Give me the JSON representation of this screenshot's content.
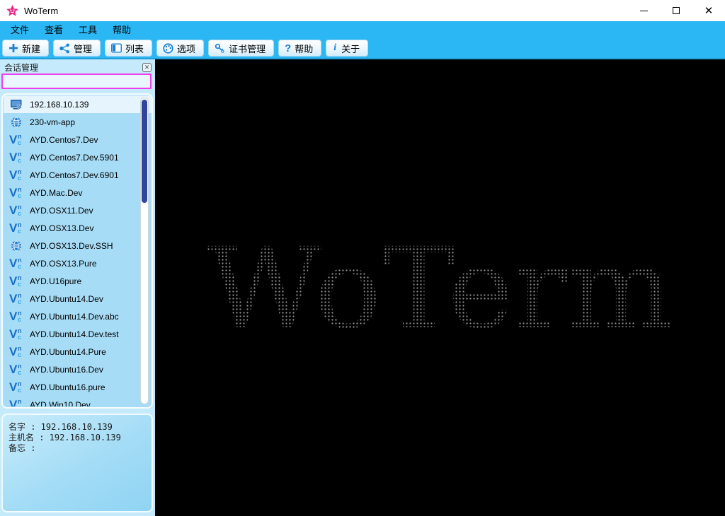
{
  "window": {
    "title": "WoTerm",
    "controls": {
      "minimize": "minimize",
      "maximize": "maximize",
      "close": "×"
    }
  },
  "menu_bar": {
    "items": [
      "文件",
      "查看",
      "工具",
      "帮助"
    ]
  },
  "toolbar": {
    "buttons": [
      {
        "icon": "plus-icon",
        "label": "新建"
      },
      {
        "icon": "share-icon",
        "label": "管理"
      },
      {
        "icon": "panel-icon",
        "label": "列表"
      },
      {
        "icon": "palette-icon",
        "label": "选项"
      },
      {
        "icon": "key-icon",
        "label": "证书管理"
      },
      {
        "icon": "question-icon",
        "label": "帮助"
      },
      {
        "icon": "info-icon",
        "label": "关于"
      }
    ]
  },
  "sidebar": {
    "title": "会话管理",
    "search": {
      "value": "",
      "placeholder": ""
    },
    "sessions": [
      {
        "name": "192.168.10.139",
        "type": "rdp",
        "selected": true
      },
      {
        "name": "230-vm-app",
        "type": "ssh",
        "selected": false
      },
      {
        "name": "AYD.Centos7.Dev",
        "type": "vnc",
        "selected": false
      },
      {
        "name": "AYD.Centos7.Dev.5901",
        "type": "vnc",
        "selected": false
      },
      {
        "name": "AYD.Centos7.Dev.6901",
        "type": "vnc",
        "selected": false
      },
      {
        "name": "AYD.Mac.Dev",
        "type": "vnc",
        "selected": false
      },
      {
        "name": "AYD.OSX11.Dev",
        "type": "vnc",
        "selected": false
      },
      {
        "name": "AYD.OSX13.Dev",
        "type": "vnc",
        "selected": false
      },
      {
        "name": "AYD.OSX13.Dev.SSH",
        "type": "ssh",
        "selected": false
      },
      {
        "name": "AYD.OSX13.Pure",
        "type": "vnc",
        "selected": false
      },
      {
        "name": "AYD.U16pure",
        "type": "vnc",
        "selected": false
      },
      {
        "name": "AYD.Ubuntu14.Dev",
        "type": "vnc",
        "selected": false
      },
      {
        "name": "AYD.Ubuntu14.Dev.abc",
        "type": "vnc",
        "selected": false
      },
      {
        "name": "AYD.Ubuntu14.Dev.test",
        "type": "vnc",
        "selected": false
      },
      {
        "name": "AYD.Ubuntu14.Pure",
        "type": "vnc",
        "selected": false
      },
      {
        "name": "AYD.Ubuntu16.Dev",
        "type": "vnc",
        "selected": false
      },
      {
        "name": "AYD.Ubuntu16.pure",
        "type": "vnc",
        "selected": false
      },
      {
        "name": "AYD.Win10.Dev",
        "type": "vnc",
        "selected": false
      }
    ],
    "details": {
      "lines": [
        {
          "label": "名字",
          "value": "192.168.10.139"
        },
        {
          "label": "主机名",
          "value": "192.168.10.139"
        },
        {
          "label": "备忘",
          "value": ""
        }
      ]
    }
  },
  "terminal": {
    "ascii_text": "WoTerm"
  },
  "colors": {
    "bar_blue": "#2ab7f4",
    "icon_blue": "#1b7fd4",
    "search_border": "#ee3ff0",
    "scroll_thumb": "#31459b",
    "selected_row": "#e6f4fd",
    "sidebar_bg": "#c5eafb",
    "list_bg": "#a7dcf6",
    "terminal_bg": "#000000",
    "ascii_dots": "#8f8f8f",
    "star_pink": "#e5318d"
  }
}
